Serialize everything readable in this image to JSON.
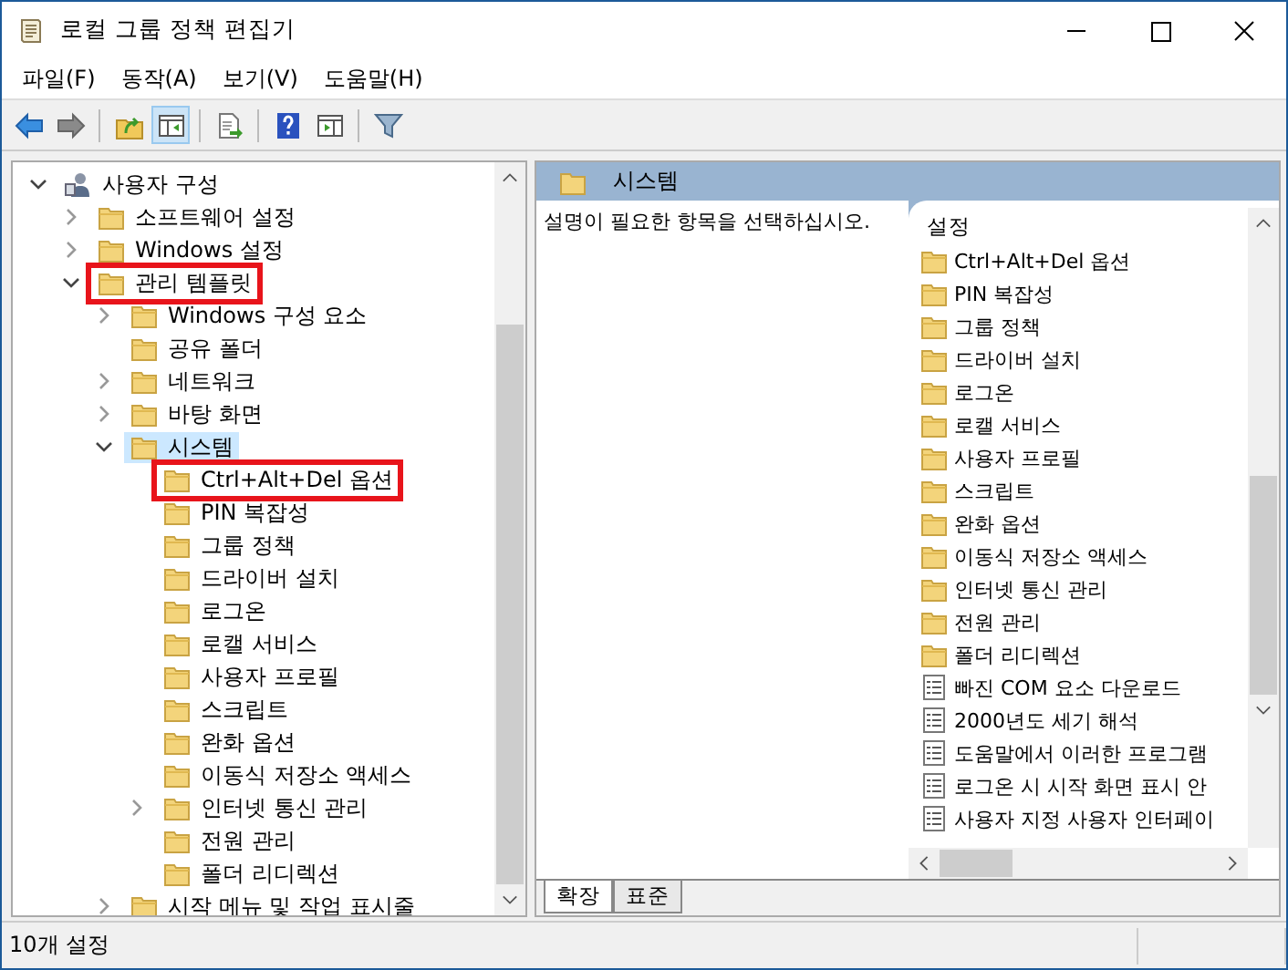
{
  "window": {
    "title": "로컬 그룹 정책 편집기"
  },
  "menu": [
    "파일(F)",
    "동작(A)",
    "보기(V)",
    "도움말(H)"
  ],
  "toolbar": [
    [
      {
        "kind": "back",
        "pressed": false
      },
      {
        "kind": "forward",
        "pressed": false
      }
    ],
    [
      {
        "kind": "up",
        "pressed": false
      },
      {
        "kind": "tree",
        "pressed": true
      }
    ],
    [
      {
        "kind": "export",
        "pressed": false
      }
    ],
    [
      {
        "kind": "help",
        "pressed": false
      },
      {
        "kind": "view",
        "pressed": false
      }
    ],
    [
      {
        "kind": "filter",
        "pressed": false
      }
    ]
  ],
  "tree": [
    {
      "label": "사용자 구성",
      "expandable": true,
      "expanded": true,
      "selected": false,
      "highlighted": false,
      "children": [
        {
          "label": "소프트웨어 설정",
          "expandable": true,
          "expanded": false,
          "selected": false,
          "highlighted": false
        },
        {
          "label": "Windows 설정",
          "expandable": true,
          "expanded": false,
          "selected": false,
          "highlighted": false
        },
        {
          "label": "관리 템플릿",
          "expandable": true,
          "expanded": true,
          "selected": false,
          "highlighted": true,
          "children": [
            {
              "label": "Windows 구성 요소",
              "expandable": true,
              "expanded": false,
              "selected": false,
              "highlighted": false
            },
            {
              "label": "공유 폴더",
              "expandable": false,
              "expanded": false,
              "selected": false,
              "highlighted": false
            },
            {
              "label": "네트워크",
              "expandable": true,
              "expanded": false,
              "selected": false,
              "highlighted": false
            },
            {
              "label": "바탕 화면",
              "expandable": true,
              "expanded": false,
              "selected": false,
              "highlighted": false
            },
            {
              "label": "시스템",
              "expandable": true,
              "expanded": true,
              "selected": true,
              "highlighted": false,
              "children": [
                {
                  "label": "Ctrl+Alt+Del 옵션",
                  "expandable": false,
                  "expanded": false,
                  "selected": false,
                  "highlighted": true
                },
                {
                  "label": "PIN 복잡성",
                  "expandable": false,
                  "expanded": false,
                  "selected": false,
                  "highlighted": false
                },
                {
                  "label": "그룹 정책",
                  "expandable": false,
                  "expanded": false,
                  "selected": false,
                  "highlighted": false
                },
                {
                  "label": "드라이버 설치",
                  "expandable": false,
                  "expanded": false,
                  "selected": false,
                  "highlighted": false
                },
                {
                  "label": "로그온",
                  "expandable": false,
                  "expanded": false,
                  "selected": false,
                  "highlighted": false
                },
                {
                  "label": "로캘 서비스",
                  "expandable": false,
                  "expanded": false,
                  "selected": false,
                  "highlighted": false
                },
                {
                  "label": "사용자 프로필",
                  "expandable": false,
                  "expanded": false,
                  "selected": false,
                  "highlighted": false
                },
                {
                  "label": "스크립트",
                  "expandable": false,
                  "expanded": false,
                  "selected": false,
                  "highlighted": false
                },
                {
                  "label": "완화 옵션",
                  "expandable": false,
                  "expanded": false,
                  "selected": false,
                  "highlighted": false
                },
                {
                  "label": "이동식 저장소 액세스",
                  "expandable": false,
                  "expanded": false,
                  "selected": false,
                  "highlighted": false
                },
                {
                  "label": "인터넷 통신 관리",
                  "expandable": true,
                  "expanded": false,
                  "selected": false,
                  "highlighted": false
                },
                {
                  "label": "전원 관리",
                  "expandable": false,
                  "expanded": false,
                  "selected": false,
                  "highlighted": false
                },
                {
                  "label": "폴더 리디렉션",
                  "expandable": false,
                  "expanded": false,
                  "selected": false,
                  "highlighted": false
                }
              ]
            },
            {
              "label": "시작 메뉴 및 작업 표시줄",
              "expandable": true,
              "expanded": false,
              "selected": false,
              "highlighted": false
            }
          ]
        }
      ]
    }
  ],
  "detail": {
    "header": "시스템",
    "description": "설명이 필요한 항목을 선택하십시오.",
    "column": "설정",
    "items": [
      {
        "kind": "folder",
        "label": "Ctrl+Alt+Del 옵션"
      },
      {
        "kind": "folder",
        "label": "PIN 복잡성"
      },
      {
        "kind": "folder",
        "label": "그룹 정책"
      },
      {
        "kind": "folder",
        "label": "드라이버 설치"
      },
      {
        "kind": "folder",
        "label": "로그온"
      },
      {
        "kind": "folder",
        "label": "로캘 서비스"
      },
      {
        "kind": "folder",
        "label": "사용자 프로필"
      },
      {
        "kind": "folder",
        "label": "스크립트"
      },
      {
        "kind": "folder",
        "label": "완화 옵션"
      },
      {
        "kind": "folder",
        "label": "이동식 저장소 액세스"
      },
      {
        "kind": "folder",
        "label": "인터넷 통신 관리"
      },
      {
        "kind": "folder",
        "label": "전원 관리"
      },
      {
        "kind": "folder",
        "label": "폴더 리디렉션"
      },
      {
        "kind": "setting",
        "label": "빠진 COM 요소 다운로드"
      },
      {
        "kind": "setting",
        "label": "2000년도 세기 해석"
      },
      {
        "kind": "setting",
        "label": "도움말에서 이러한 프로그램"
      },
      {
        "kind": "setting",
        "label": "로그온 시 시작 화면 표시 안"
      },
      {
        "kind": "setting",
        "label": "사용자 지정 사용자 인터페이"
      }
    ]
  },
  "tabs": [
    {
      "label": "확장",
      "selected": true
    },
    {
      "label": "표준",
      "selected": false
    }
  ],
  "status_bar": "10개 설정"
}
